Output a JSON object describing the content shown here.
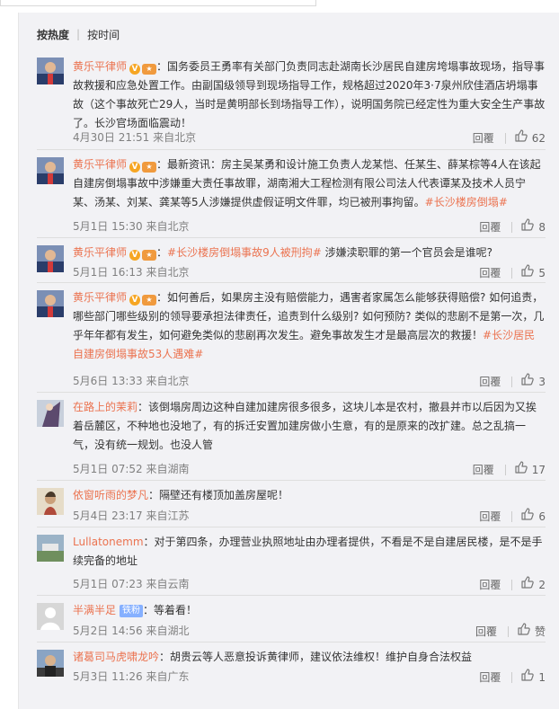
{
  "sort": {
    "active": "按热度",
    "other": "按时间"
  },
  "colors": {
    "username": "#eb7350",
    "background": "#f2f2f5",
    "meta": "#808080"
  },
  "actions": {
    "reply_label": "回覆"
  },
  "comments": [
    {
      "user": "黄乐平律师",
      "verified": true,
      "medal": true,
      "text": "：国务委员王勇率有关部门负责同志赴湖南长沙居民自建房垮塌事故现场，指导事故救援和应急处置工作。由副国级领导到现场指导工作，规格超过2020年3·7泉州欣佳酒店坍塌事故（这个事故死亡29人，当时是黄明部长到场指导工作），说明国务院已经定性为重大安全生产事故了。长沙官场面临震动！",
      "tag": "",
      "time": "4月30日 21:51 来自北京",
      "likes": "62"
    },
    {
      "user": "黄乐平律师",
      "verified": true,
      "medal": true,
      "text": "：最新资讯：房主吴某勇和设计施工负责人龙某恺、任某生、薛某棕等4人在该起自建房倒塌事故中涉嫌重大责任事故罪，湖南湘大工程检测有限公司法人代表谭某及技术人员宁某、汤某、刘某、龚某等5人涉嫌提供虚假证明文件罪，均已被刑事拘留。",
      "tag": "#长沙楼房倒塌#",
      "time": "5月1日 15:30 来自北京",
      "likes": "8"
    },
    {
      "user": "黄乐平律师",
      "verified": true,
      "medal": true,
      "text": "：",
      "tag": "#长沙楼房倒塌事故9人被刑拘#",
      "text2": " 涉嫌渎职罪的第一个官员会是谁呢?",
      "time": "5月1日 16:13 来自北京",
      "likes": "5"
    },
    {
      "user": "黄乐平律师",
      "verified": true,
      "medal": true,
      "text": "：如何善后，如果房主没有赔偿能力，遇害者家属怎么能够获得赔偿? 如何追责，哪些部门哪些级别的领导要承担法律责任，追责到什么级别? 如何预防? 类似的悲剧不是第一次，几乎年年都有发生，如何避免类似的悲剧再次发生。避免事故发生才是最高层次的救援！",
      "tag": "#长沙居民自建房倒塌事故53人遇难#",
      "time": "5月6日 13:33 来自北京",
      "likes": "3"
    },
    {
      "user": "在路上的茉莉",
      "verified": false,
      "medal": false,
      "text": "：该倒塌房周边这种自建加建房很多很多，这块儿本是农村，撤县并市以后因为又挨着岳麓区，不种地也没地了，有的拆迁安置加建房做小生意，有的是原来的改扩建。总之乱搞一气，没有统一规划。也没人管",
      "tag": "",
      "time": "5月1日 07:52 来自湖南",
      "likes": "17"
    },
    {
      "user": "依窗听雨的梦凡",
      "verified": false,
      "medal": false,
      "text": "：隔壁还有楼顶加盖房屋呢！",
      "tag": "",
      "time": "5月4日 23:17 来自江苏",
      "likes": "6"
    },
    {
      "user": "Lullatonemm",
      "verified": false,
      "medal": false,
      "text": "：对于第四条，办理营业执照地址由办理者提供，不看是不是自建居民楼，是不是手续完备的地址",
      "tag": "",
      "time": "5月1日 07:23 来自云南",
      "likes": "2"
    },
    {
      "user": "半满半足",
      "verified": false,
      "medal": false,
      "fans_badge": "铁粉",
      "text": "：等着看！",
      "tag": "",
      "time": "5月2日 14:56 来自湖北",
      "likes": "赞"
    },
    {
      "user": "诸葛司马虎啸龙吟",
      "verified": false,
      "medal": false,
      "text": "：胡贵云等人恶意投诉黄律师，建议依法维权！维护自身合法权益",
      "tag": "",
      "time": "5月3日 11:26 来自广东",
      "likes": "1"
    }
  ]
}
